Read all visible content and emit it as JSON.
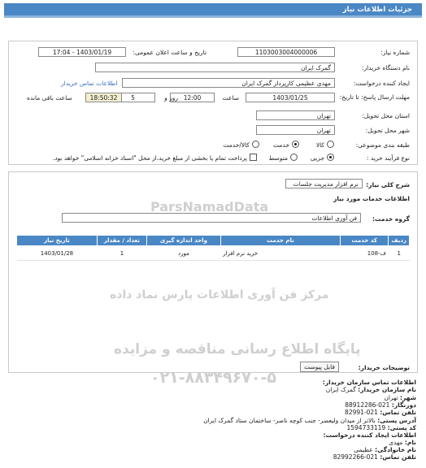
{
  "header": {
    "title": "جزئیات اطلاعات نیاز"
  },
  "general": {
    "need_number_label": "شماره نیاز:",
    "need_number": "1103003004000006",
    "announce_label": "تاریخ و ساعت اعلان عمومی:",
    "announce_value": "1403/01/19 - 17:04",
    "buyer_org_label": "نام دستگاه خریدار:",
    "buyer_org": "گمرک ایران",
    "creator_label": "ایجاد کننده درخواست:",
    "creator": "مهدی عظیمی کارپرداز گمرک ایران",
    "contact_link": "اطلاعات تماس خریدار",
    "deadline_label": "مهلت ارسال پاسخ: تا تاریخ:",
    "deadline_date": "1403/01/25",
    "time_label": "ساعت",
    "deadline_time": "12:00",
    "days_value": "5",
    "days_label": "روز و",
    "remaining_time": "18:50:32",
    "remaining_label": "ساعت باقی مانده",
    "province_label": "استان محل تحویل:",
    "province": "تهران",
    "city_label": "شهر محل تحویل:",
    "city": "تهران",
    "category_label": "طبقه بندی موضوعی:",
    "category_options": [
      "کالا",
      "خدمت",
      "کالا/خدمت"
    ],
    "process_label": "نوع فرآیند خرید :",
    "process_options": [
      "جزیی",
      "متوسط"
    ],
    "payment_note": "پرداخت تمام یا بخشی از مبلغ خرید،از محل \"اسناد خزانه اسلامی\" خواهد بود."
  },
  "details": {
    "summary_label": "شرح کلی نیاز:",
    "summary": "نرم افزار مدیریت جلسات",
    "services_heading": "اطلاعات خدمات مورد نیاز",
    "service_group_label": "گروه خدمت:",
    "service_group": "فن آوری اطلاعات",
    "table": {
      "headers": [
        "ردیف",
        "کد خدمت",
        "نام خدمت",
        "واحد اندازه گیری",
        "تعداد / مقدار",
        "تاریخ نیاز"
      ],
      "rows": [
        [
          "1",
          "ف-108",
          "خرید نرم افزار",
          "مورد",
          "1",
          "1403/01/28"
        ]
      ]
    },
    "buyer_notes_label": "توضیحات خریدار:",
    "attachment_button": "فایل پیوست"
  },
  "contact": {
    "heading": "اطلاعات تماس سازمان خریدار:",
    "org_name_label": "نام سازمان خریدار:",
    "org_name": "گمرک ایران",
    "city_label": "شهر:",
    "city": "تهران",
    "fax_label": "دورنگار:",
    "fax": "021-88912286",
    "phone_label": "تلفن تماس:",
    "phone": "021-82991",
    "address_label": "آدرس پستی:",
    "address": "بالاتر از میدان ولیعصر- جنب کوچه ناصر- ساختمان ستاد گمرک ایران",
    "postal_label": "کد پستی:",
    "postal": "1594733119",
    "creator_heading": "اطلاعات ایجاد کننده درخواست:",
    "first_name_label": "نام:",
    "first_name": "مهدی",
    "last_name_label": "نام خانوادگی:",
    "last_name": "عظیمی",
    "creator_phone_label": "تلفن تماس:",
    "creator_phone": "021-82992266"
  },
  "watermark": {
    "line1": "پایگاه اطلاع رسانی مناقصه و مزایده",
    "line2": "۰۲۱-۸۸۳۴۹۶۷۰-۵",
    "line3": "ParsNamadData",
    "line4": "مرکز فن آوری اطلاعات پارس نماد داده"
  },
  "colors": {
    "header": "#4a87c5",
    "table_header": "#4a87c5",
    "link": "#3a6fbf"
  }
}
